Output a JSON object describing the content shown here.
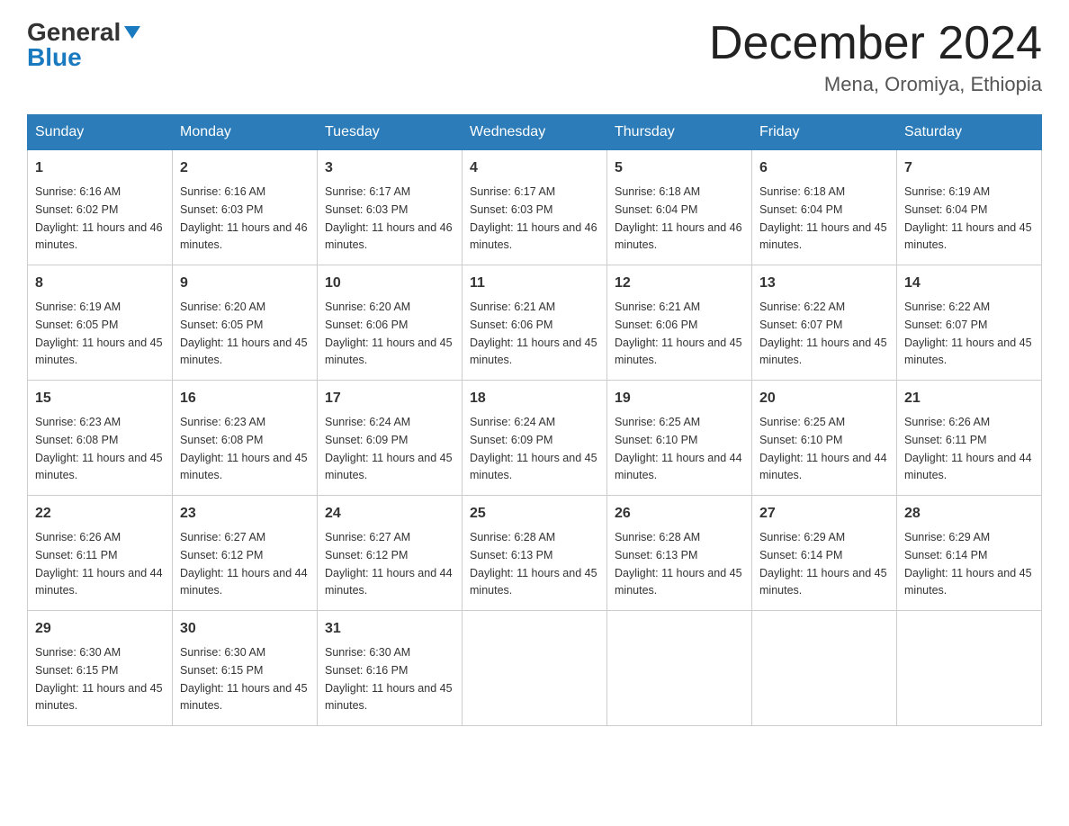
{
  "logo": {
    "general_text": "General",
    "blue_text": "Blue"
  },
  "header": {
    "month": "December 2024",
    "location": "Mena, Oromiya, Ethiopia"
  },
  "days_of_week": [
    "Sunday",
    "Monday",
    "Tuesday",
    "Wednesday",
    "Thursday",
    "Friday",
    "Saturday"
  ],
  "weeks": [
    [
      {
        "day": "1",
        "sunrise": "6:16 AM",
        "sunset": "6:02 PM",
        "daylight": "11 hours and 46 minutes."
      },
      {
        "day": "2",
        "sunrise": "6:16 AM",
        "sunset": "6:03 PM",
        "daylight": "11 hours and 46 minutes."
      },
      {
        "day": "3",
        "sunrise": "6:17 AM",
        "sunset": "6:03 PM",
        "daylight": "11 hours and 46 minutes."
      },
      {
        "day": "4",
        "sunrise": "6:17 AM",
        "sunset": "6:03 PM",
        "daylight": "11 hours and 46 minutes."
      },
      {
        "day": "5",
        "sunrise": "6:18 AM",
        "sunset": "6:04 PM",
        "daylight": "11 hours and 46 minutes."
      },
      {
        "day": "6",
        "sunrise": "6:18 AM",
        "sunset": "6:04 PM",
        "daylight": "11 hours and 45 minutes."
      },
      {
        "day": "7",
        "sunrise": "6:19 AM",
        "sunset": "6:04 PM",
        "daylight": "11 hours and 45 minutes."
      }
    ],
    [
      {
        "day": "8",
        "sunrise": "6:19 AM",
        "sunset": "6:05 PM",
        "daylight": "11 hours and 45 minutes."
      },
      {
        "day": "9",
        "sunrise": "6:20 AM",
        "sunset": "6:05 PM",
        "daylight": "11 hours and 45 minutes."
      },
      {
        "day": "10",
        "sunrise": "6:20 AM",
        "sunset": "6:06 PM",
        "daylight": "11 hours and 45 minutes."
      },
      {
        "day": "11",
        "sunrise": "6:21 AM",
        "sunset": "6:06 PM",
        "daylight": "11 hours and 45 minutes."
      },
      {
        "day": "12",
        "sunrise": "6:21 AM",
        "sunset": "6:06 PM",
        "daylight": "11 hours and 45 minutes."
      },
      {
        "day": "13",
        "sunrise": "6:22 AM",
        "sunset": "6:07 PM",
        "daylight": "11 hours and 45 minutes."
      },
      {
        "day": "14",
        "sunrise": "6:22 AM",
        "sunset": "6:07 PM",
        "daylight": "11 hours and 45 minutes."
      }
    ],
    [
      {
        "day": "15",
        "sunrise": "6:23 AM",
        "sunset": "6:08 PM",
        "daylight": "11 hours and 45 minutes."
      },
      {
        "day": "16",
        "sunrise": "6:23 AM",
        "sunset": "6:08 PM",
        "daylight": "11 hours and 45 minutes."
      },
      {
        "day": "17",
        "sunrise": "6:24 AM",
        "sunset": "6:09 PM",
        "daylight": "11 hours and 45 minutes."
      },
      {
        "day": "18",
        "sunrise": "6:24 AM",
        "sunset": "6:09 PM",
        "daylight": "11 hours and 45 minutes."
      },
      {
        "day": "19",
        "sunrise": "6:25 AM",
        "sunset": "6:10 PM",
        "daylight": "11 hours and 44 minutes."
      },
      {
        "day": "20",
        "sunrise": "6:25 AM",
        "sunset": "6:10 PM",
        "daylight": "11 hours and 44 minutes."
      },
      {
        "day": "21",
        "sunrise": "6:26 AM",
        "sunset": "6:11 PM",
        "daylight": "11 hours and 44 minutes."
      }
    ],
    [
      {
        "day": "22",
        "sunrise": "6:26 AM",
        "sunset": "6:11 PM",
        "daylight": "11 hours and 44 minutes."
      },
      {
        "day": "23",
        "sunrise": "6:27 AM",
        "sunset": "6:12 PM",
        "daylight": "11 hours and 44 minutes."
      },
      {
        "day": "24",
        "sunrise": "6:27 AM",
        "sunset": "6:12 PM",
        "daylight": "11 hours and 44 minutes."
      },
      {
        "day": "25",
        "sunrise": "6:28 AM",
        "sunset": "6:13 PM",
        "daylight": "11 hours and 45 minutes."
      },
      {
        "day": "26",
        "sunrise": "6:28 AM",
        "sunset": "6:13 PM",
        "daylight": "11 hours and 45 minutes."
      },
      {
        "day": "27",
        "sunrise": "6:29 AM",
        "sunset": "6:14 PM",
        "daylight": "11 hours and 45 minutes."
      },
      {
        "day": "28",
        "sunrise": "6:29 AM",
        "sunset": "6:14 PM",
        "daylight": "11 hours and 45 minutes."
      }
    ],
    [
      {
        "day": "29",
        "sunrise": "6:30 AM",
        "sunset": "6:15 PM",
        "daylight": "11 hours and 45 minutes."
      },
      {
        "day": "30",
        "sunrise": "6:30 AM",
        "sunset": "6:15 PM",
        "daylight": "11 hours and 45 minutes."
      },
      {
        "day": "31",
        "sunrise": "6:30 AM",
        "sunset": "6:16 PM",
        "daylight": "11 hours and 45 minutes."
      },
      {
        "day": "",
        "sunrise": "",
        "sunset": "",
        "daylight": ""
      },
      {
        "day": "",
        "sunrise": "",
        "sunset": "",
        "daylight": ""
      },
      {
        "day": "",
        "sunrise": "",
        "sunset": "",
        "daylight": ""
      },
      {
        "day": "",
        "sunrise": "",
        "sunset": "",
        "daylight": ""
      }
    ]
  ]
}
